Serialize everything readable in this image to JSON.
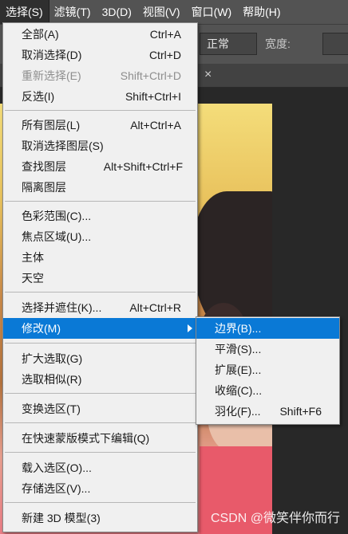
{
  "menubar": {
    "items": [
      "选择(S)",
      "滤镜(T)",
      "3D(D)",
      "视图(V)",
      "窗口(W)",
      "帮助(H)"
    ]
  },
  "options": {
    "style_value": "正常",
    "width_label": "宽度:"
  },
  "tab": {
    "close_glyph": "×"
  },
  "select_menu": {
    "items": [
      {
        "label": "全部(A)",
        "shortcut": "Ctrl+A"
      },
      {
        "label": "取消选择(D)",
        "shortcut": "Ctrl+D"
      },
      {
        "label": "重新选择(E)",
        "shortcut": "Shift+Ctrl+D"
      },
      {
        "label": "反选(I)",
        "shortcut": "Shift+Ctrl+I"
      },
      {
        "label": "所有图层(L)",
        "shortcut": "Alt+Ctrl+A"
      },
      {
        "label": "取消选择图层(S)",
        "shortcut": ""
      },
      {
        "label": "查找图层",
        "shortcut": "Alt+Shift+Ctrl+F"
      },
      {
        "label": "隔离图层",
        "shortcut": ""
      },
      {
        "label": "色彩范围(C)...",
        "shortcut": ""
      },
      {
        "label": "焦点区域(U)...",
        "shortcut": ""
      },
      {
        "label": "主体",
        "shortcut": ""
      },
      {
        "label": "天空",
        "shortcut": ""
      },
      {
        "label": "选择并遮住(K)...",
        "shortcut": "Alt+Ctrl+R"
      },
      {
        "label": "修改(M)",
        "shortcut": ""
      },
      {
        "label": "扩大选取(G)",
        "shortcut": ""
      },
      {
        "label": "选取相似(R)",
        "shortcut": ""
      },
      {
        "label": "变换选区(T)",
        "shortcut": ""
      },
      {
        "label": "在快速蒙版模式下编辑(Q)",
        "shortcut": ""
      },
      {
        "label": "载入选区(O)...",
        "shortcut": ""
      },
      {
        "label": "存储选区(V)...",
        "shortcut": ""
      },
      {
        "label": "新建 3D 模型(3)",
        "shortcut": ""
      }
    ]
  },
  "modify_submenu": {
    "items": [
      {
        "label": "边界(B)...",
        "shortcut": ""
      },
      {
        "label": "平滑(S)...",
        "shortcut": ""
      },
      {
        "label": "扩展(E)...",
        "shortcut": ""
      },
      {
        "label": "收缩(C)...",
        "shortcut": ""
      },
      {
        "label": "羽化(F)...",
        "shortcut": "Shift+F6"
      }
    ]
  },
  "watermark": "CSDN @微笑伴你而行",
  "colors": {
    "highlight": "#0a79d6",
    "menu_bg": "#f0f0f0",
    "app_bar": "#535353"
  }
}
